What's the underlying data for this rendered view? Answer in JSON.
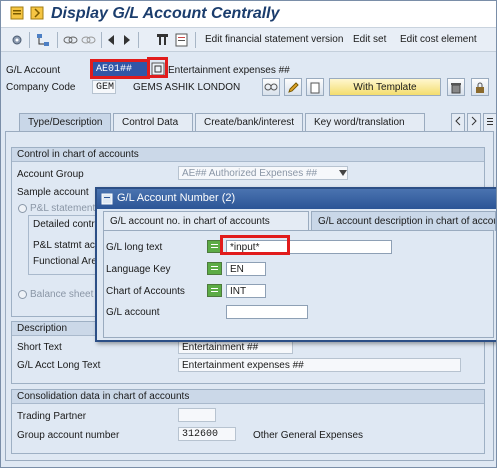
{
  "window": {
    "title": "Display G/L Account Centrally"
  },
  "toolbar": {
    "edit_fs_version": "Edit financial statement version",
    "edit_set": "Edit set",
    "edit_cost_element": "Edit cost element"
  },
  "header": {
    "gl_account_label": "G/L Account",
    "gl_account_value": "AE01##",
    "gl_account_desc": "Entertainment expenses ##",
    "company_code_label": "Company Code",
    "company_code_value": "GEM",
    "company_name": "GEMS ASHIK LONDON",
    "with_template": "With Template"
  },
  "tabs": [
    "Type/Description",
    "Control Data",
    "Create/bank/interest",
    "Key word/translation"
  ],
  "control_group": {
    "title": "Control in chart of accounts",
    "account_group_label": "Account Group",
    "account_group_value": "AE## Authorized Expenses ##",
    "sample_account_label": "Sample account",
    "pl_statement_label": "P&L statement",
    "detailed_control_label": "Detailed contr",
    "pl_statmt_label": "P&L statmt ac",
    "functional_area_label": "Functional Are",
    "balance_sheet_label": "Balance sheet a"
  },
  "description_group": {
    "title": "Description",
    "short_text_label": "Short Text",
    "short_text_value": "Entertainment ##",
    "long_text_label": "G/L Acct Long Text",
    "long_text_value": "Entertainment expenses ##"
  },
  "consolidation_group": {
    "title": "Consolidation data in chart of accounts",
    "trading_partner_label": "Trading Partner",
    "group_account_label": "Group account number",
    "group_account_value": "312600",
    "group_account_desc": "Other General Expenses"
  },
  "dialog": {
    "title": "G/L Account Number (2)",
    "tab1": "G/L account no. in chart of accounts",
    "tab2": "G/L account description in chart of accou",
    "long_text_label": "G/L long text",
    "long_text_value": "*input*",
    "language_label": "Language Key",
    "language_value": "EN",
    "chart_label": "Chart of Accounts",
    "chart_value": "INT",
    "gl_account_label": "G/L account"
  },
  "colors": {
    "highlight_red": "#e11c1c",
    "title_blue": "#1b3d6d",
    "dialog_title": "#2c5596",
    "green_button": "#5cab45"
  }
}
